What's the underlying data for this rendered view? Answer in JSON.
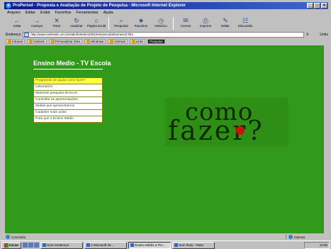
{
  "window": {
    "title": "ProPeriod - Proposta e Avaliação de Projeto de Pesquisa - Microsoft Internet Explorer",
    "controls": [
      "_",
      "□",
      "×"
    ]
  },
  "menubar": [
    "Arquivo",
    "Editar",
    "Exibir",
    "Favoritos",
    "Ferramentas",
    "Ajuda"
  ],
  "toolbar": [
    {
      "label": "Voltar",
      "icon": "back-arrow-icon",
      "glyph": "←"
    },
    {
      "label": "Avançar",
      "icon": "forward-arrow-icon",
      "glyph": "→"
    },
    {
      "label": "Parar",
      "icon": "stop-icon",
      "glyph": "✕"
    },
    {
      "label": "Atualizar",
      "icon": "refresh-icon",
      "glyph": "↻"
    },
    {
      "label": "Página inicial",
      "icon": "home-icon",
      "glyph": "⌂"
    },
    {
      "label": "Pesquisar",
      "icon": "search-icon",
      "glyph": "⌕"
    },
    {
      "label": "Favoritos",
      "icon": "favorites-icon",
      "glyph": "★"
    },
    {
      "label": "Histórico",
      "icon": "history-icon",
      "glyph": "◷"
    },
    {
      "label": "Correio",
      "icon": "mail-icon",
      "glyph": "✉"
    },
    {
      "label": "Imprimir",
      "icon": "print-icon",
      "glyph": "⎙"
    },
    {
      "label": "Editar",
      "icon": "edit-icon",
      "glyph": "✎"
    },
    {
      "label": "Discussão",
      "icon": "discuss-icon",
      "glyph": "☷"
    }
  ],
  "addressbar": {
    "label": "Endereço",
    "url": "http://www.tvebrasil.com.br/salto/boletins2001/emtvescola/tvemesc0.htm",
    "go_label": "Ir",
    "links_label": "Links"
  },
  "linksbar": [
    {
      "label": "Intranet",
      "style": "chip"
    },
    {
      "label": "Outlook",
      "style": "chip"
    },
    {
      "label": "Personalizar links",
      "style": "chip"
    },
    {
      "label": "Windows",
      "style": "chip"
    },
    {
      "label": "Hotmail",
      "style": "chip"
    },
    {
      "label": "Links",
      "style": "chip"
    },
    {
      "label": "Pesquisa",
      "style": "dark"
    }
  ],
  "page": {
    "heading": "Ensino Medio - TV Escola",
    "menu": [
      "Programas de ajuda como fazer?",
      "Laboratório",
      "Materiais pesquisa técnicos",
      "Consultar as apresentações",
      "Mídias que apresentamos",
      "Cadastre suas aulas",
      "Para que o Ensino Médio"
    ],
    "logo_line1": "como",
    "logo_line2": "fazer?"
  },
  "status": {
    "left": "Concluído",
    "zone": "Internet"
  },
  "taskbar": {
    "start": "Iniciar",
    "buttons": [
      {
        "label": "Novo Endereço",
        "active": false
      },
      {
        "label": "2 Microsoft Int...",
        "active": false
      },
      {
        "label": "Ensino Médio a Pro...",
        "active": true
      },
      {
        "label": "Sem título - Paint",
        "active": false
      }
    ],
    "clock": "10:55"
  },
  "colors": {
    "page_bg": "#329a1a",
    "menu_highlight": "#ffff40",
    "logo_dot": "#d01010",
    "title_bar": "#0a1a8a"
  }
}
